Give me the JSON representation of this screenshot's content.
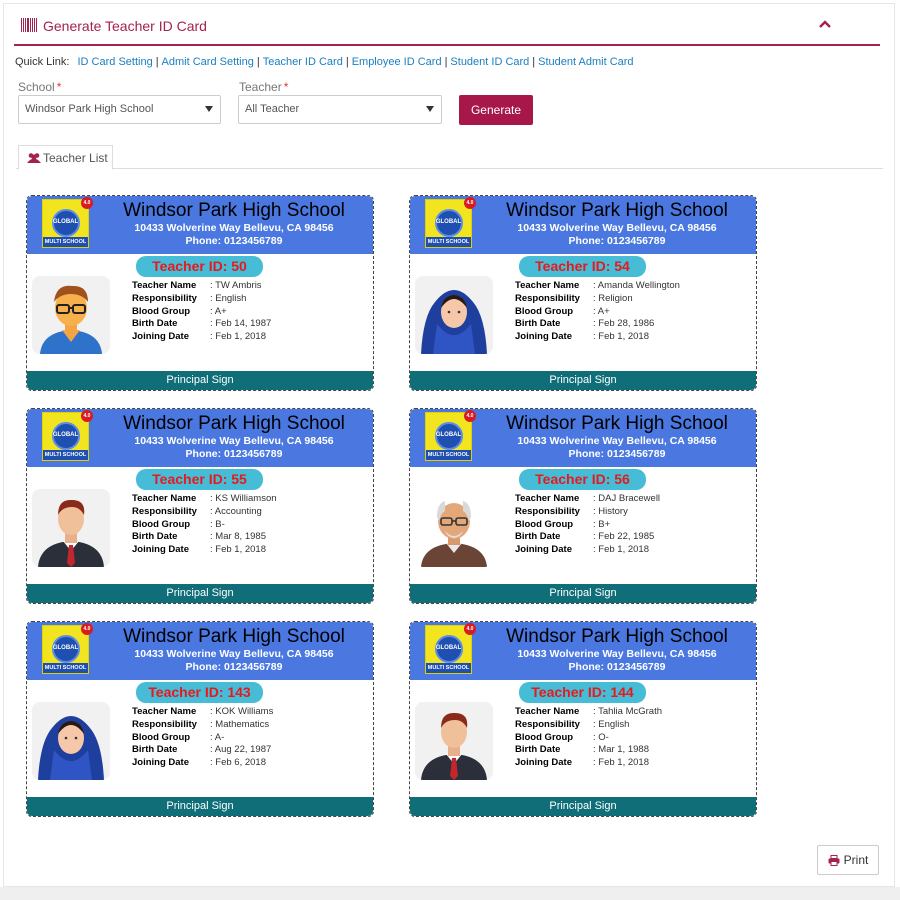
{
  "header": {
    "title": "Generate Teacher ID Card"
  },
  "quick_links": {
    "label": "Quick Link:",
    "links": [
      "ID Card Setting",
      "Admit Card Setting",
      "Teacher ID Card",
      "Employee ID Card",
      "Student ID Card",
      "Student Admit Card"
    ]
  },
  "filters": {
    "school_label": "School",
    "school_value": "Windsor Park High School",
    "teacher_label": "Teacher",
    "teacher_value": "All Teacher",
    "generate_label": "Generate"
  },
  "tabs": {
    "teacher_list": "Teacher List"
  },
  "card_common": {
    "school_name": "Windsor Park High School",
    "address": "10433 Wolverine Way Bellevu, CA 98456",
    "phone": "Phone: 0123456789",
    "footer": "Principal Sign",
    "field_labels": [
      "Teacher Name",
      "Responsibility",
      "Blood Group",
      "Birth Date",
      "Joining Date"
    ],
    "logo_top": "GLOBAL",
    "logo_bottom": "MULTI SCHOOL",
    "logo_badge": "4.0"
  },
  "cards": [
    {
      "id_label": "Teacher ID: 50",
      "name": ": TW Ambris",
      "responsibility": ": English",
      "blood_group": ": A+",
      "birth_date": ": Feb 14, 1987",
      "joining_date": ": Feb 1, 2018",
      "avatar": "male-glasses-avatar"
    },
    {
      "id_label": "Teacher ID: 54",
      "name": ": Amanda Wellington",
      "responsibility": ": Religion",
      "blood_group": ": A+",
      "birth_date": ": Feb 28, 1986",
      "joining_date": ": Feb 1, 2018",
      "avatar": "female-hijab-avatar"
    },
    {
      "id_label": "Teacher ID: 55",
      "name": ": KS Williamson",
      "responsibility": ": Accounting",
      "blood_group": ": B-",
      "birth_date": ": Mar 8, 1985",
      "joining_date": ": Feb 1, 2018",
      "avatar": "male-suit-avatar"
    },
    {
      "id_label": "Teacher ID: 56",
      "name": ": DAJ Bracewell",
      "responsibility": ": History",
      "blood_group": ": B+",
      "birth_date": ": Feb 22, 1985",
      "joining_date": ": Feb 1, 2018",
      "avatar": "elder-male-avatar"
    },
    {
      "id_label": "Teacher ID: 143",
      "name": ": KOK Williams",
      "responsibility": ": Mathematics",
      "blood_group": ": A-",
      "birth_date": ": Aug 22, 1987",
      "joining_date": ": Feb 6, 2018",
      "avatar": "female-hijab-avatar"
    },
    {
      "id_label": "Teacher ID: 144",
      "name": ": Tahlia McGrath",
      "responsibility": ": English",
      "blood_group": ": O-",
      "birth_date": ": Mar 1, 1988",
      "joining_date": ": Feb 1, 2018",
      "avatar": "male-suit-avatar"
    }
  ],
  "print_label": "Print",
  "colors": {
    "accent": "#a3234e",
    "card_header": "#4a78e0",
    "card_footer": "#0f6e78",
    "id_pill": "#46bcd6",
    "id_text": "#e8191c",
    "link": "#1a7fc1"
  }
}
